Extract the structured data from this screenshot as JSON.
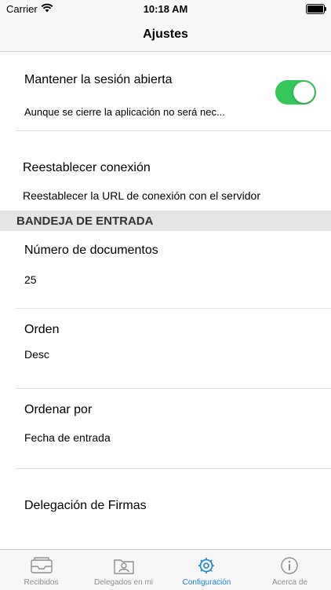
{
  "status_bar": {
    "carrier": "Carrier",
    "time": "10:18 AM"
  },
  "nav": {
    "title": "Ajustes"
  },
  "settings": {
    "keep_session": {
      "label": "Mantener la sesión abierta",
      "subtitle": "Aunque se cierre la aplicación no será nec...",
      "enabled": true
    },
    "reset_connection": {
      "label": "Reestablecer conexión",
      "subtitle": "Reestablecer la URL de conexión con el servidor"
    }
  },
  "inbox_section": {
    "header": "BANDEJA DE ENTRADA",
    "items": [
      {
        "label": "Número de documentos",
        "value": "25"
      },
      {
        "label": "Orden",
        "value": "Desc"
      },
      {
        "label": "Ordenar por",
        "value": "Fecha de entrada"
      },
      {
        "label": "Delegación de Firmas",
        "value": ""
      }
    ]
  },
  "tab_bar": {
    "tabs": [
      {
        "label": "Recibidos",
        "icon": "tray-icon",
        "active": false
      },
      {
        "label": "Delegados en mi",
        "icon": "folder-person-icon",
        "active": false
      },
      {
        "label": "Configuración",
        "icon": "gear-icon",
        "active": true
      },
      {
        "label": "Acerca de",
        "icon": "info-icon",
        "active": false
      }
    ]
  },
  "colors": {
    "accent": "#1a82d3",
    "toggle_on": "#34c759",
    "section_bg": "#e5e5e5"
  }
}
